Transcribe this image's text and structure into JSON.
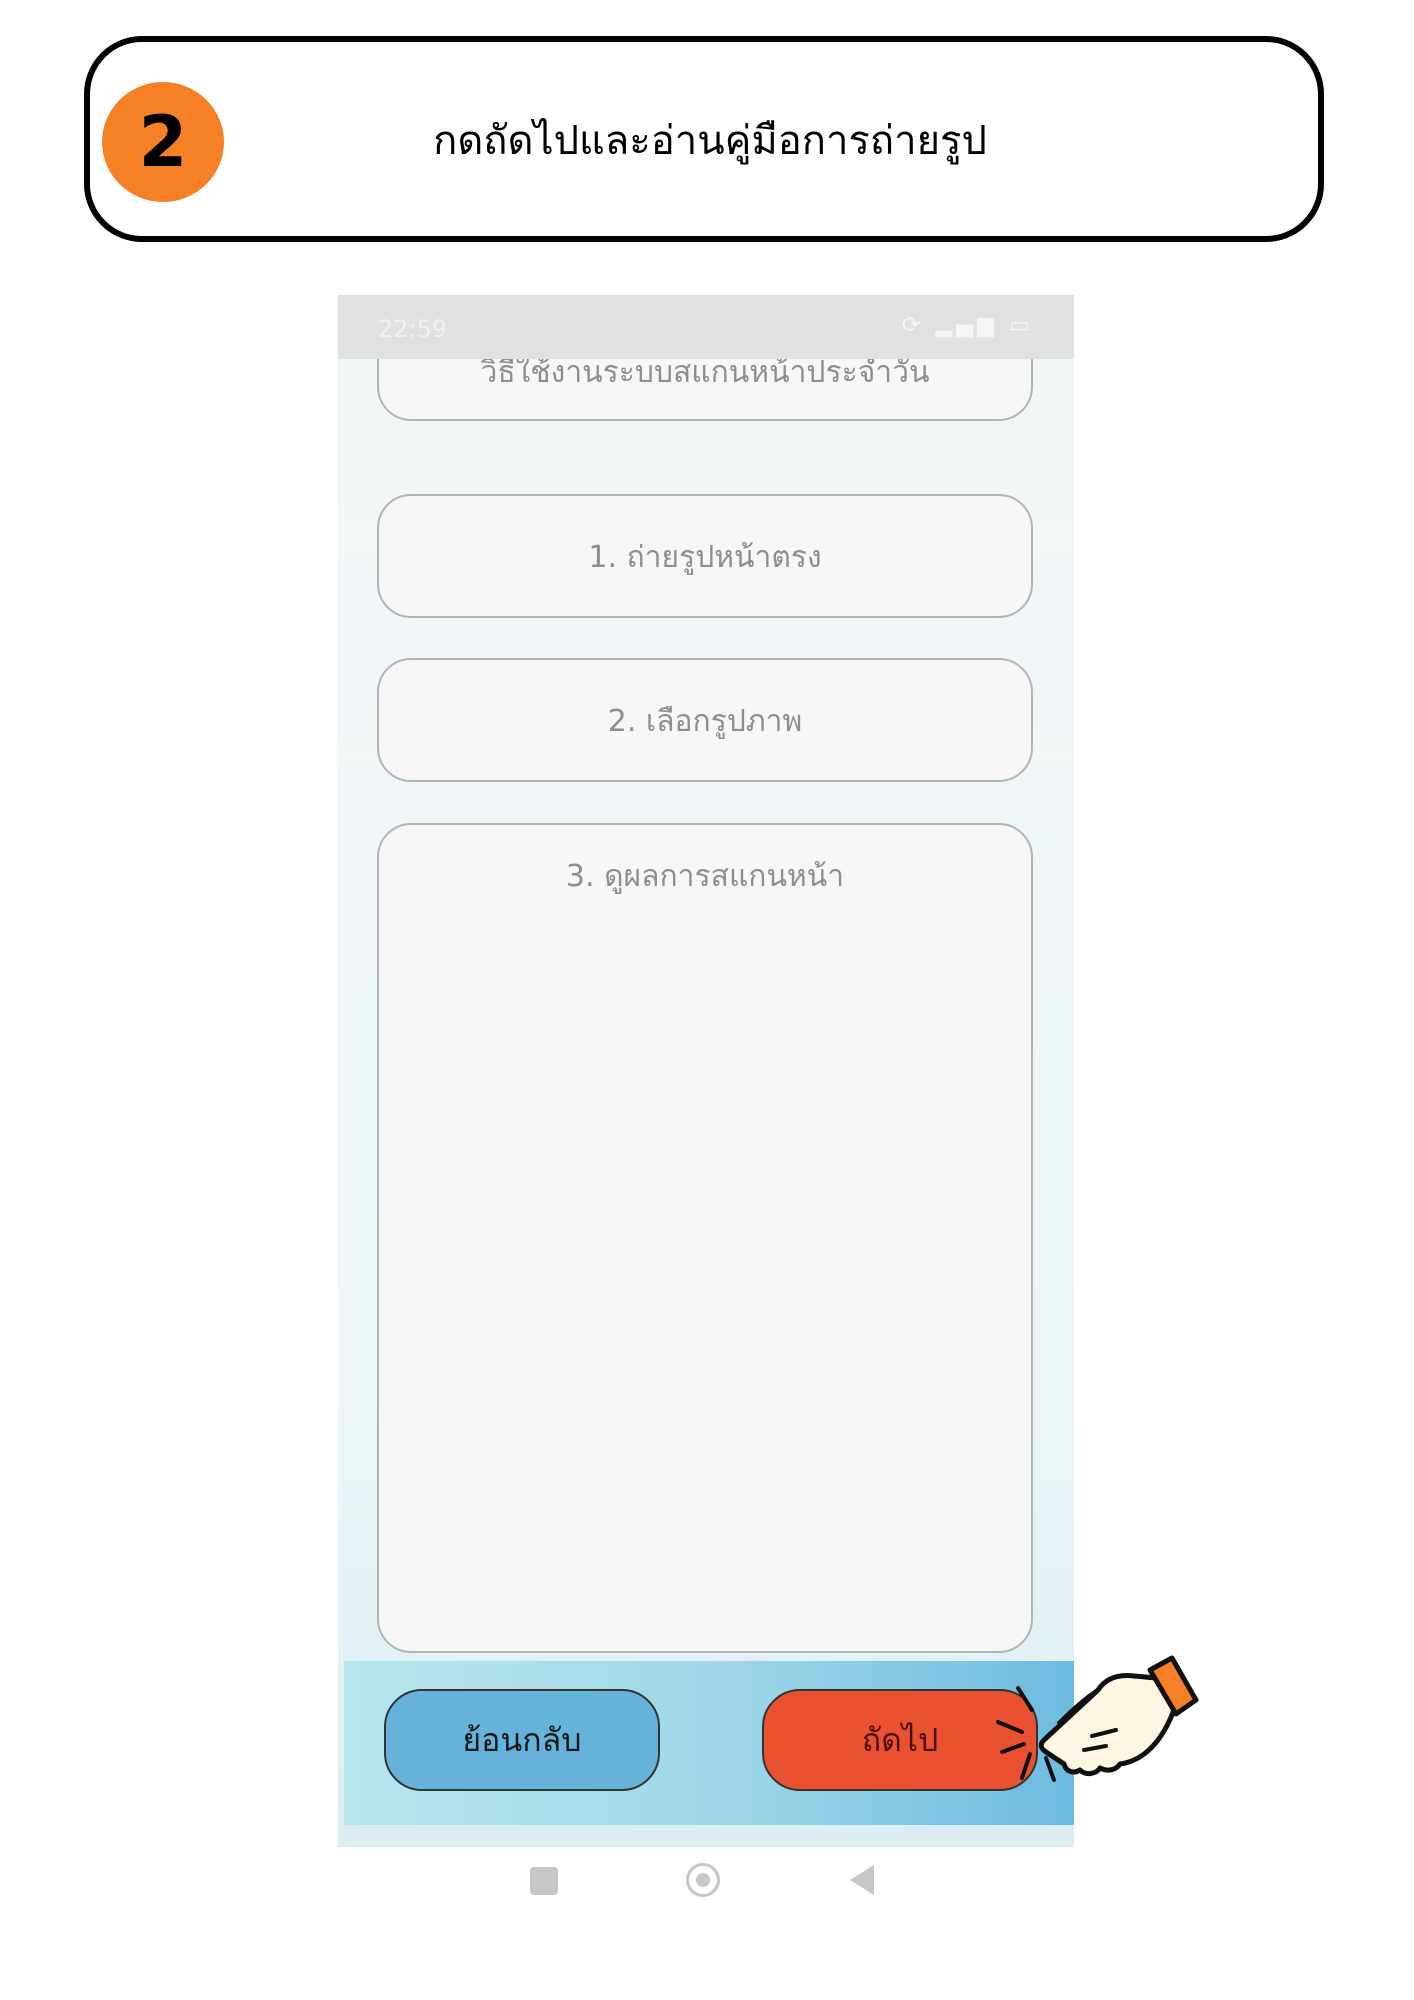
{
  "step": {
    "number": "2",
    "title": "กดถัดไปและอ่านคู่มือการถ่ายรูป"
  },
  "status_bar": {
    "time": "22:59",
    "icons": [
      "sync-icon",
      "signal-icon",
      "battery-icon"
    ]
  },
  "guide": {
    "header": "วิธีใช้งานระบบสแกนหน้าประจำวัน",
    "steps": [
      "1. ถ่ายรูปหน้าตรง",
      "2. เลือกรูปภาพ",
      "3. ดูผลการสแกนหน้า"
    ]
  },
  "actions": {
    "back_label": "ย้อนกลับ",
    "next_label": "ถัดไป"
  },
  "colors": {
    "badge": "#f58025",
    "next_button": "#ea5130",
    "back_button": "#65b3db"
  },
  "pointer": "pointing-hand-icon"
}
